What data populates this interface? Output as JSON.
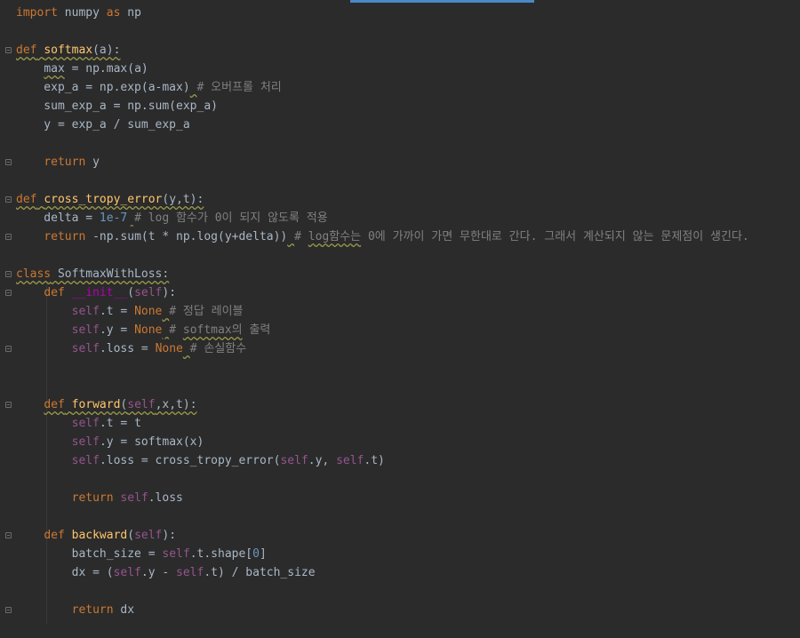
{
  "editor": {
    "lines": [
      [
        {
          "t": "import",
          "c": "kw"
        },
        {
          "t": " numpy "
        },
        {
          "t": "as",
          "c": "kw"
        },
        {
          "t": " np"
        }
      ],
      [],
      [
        {
          "t": "def",
          "c": "kw sqg"
        },
        {
          "t": " ",
          "c": "sqg"
        },
        {
          "t": "softmax",
          "c": "fn sqg"
        },
        {
          "t": "(a):",
          "c": "sqg"
        }
      ],
      [
        {
          "t": "    "
        },
        {
          "t": "max",
          "c": "sqg"
        },
        {
          "t": " = np.max(a)"
        }
      ],
      [
        {
          "t": "    exp_a = np.exp(a-max)"
        },
        {
          "t": " ",
          "c": "sqg"
        },
        {
          "t": "# 오버프롤 처리",
          "c": "cm"
        }
      ],
      [
        {
          "t": "    sum_exp_a = np.sum(exp_a)"
        }
      ],
      [
        {
          "t": "    y = exp_a / sum_exp_a"
        }
      ],
      [],
      [
        {
          "t": "    "
        },
        {
          "t": "return",
          "c": "kw"
        },
        {
          "t": " y"
        }
      ],
      [],
      [
        {
          "t": "def",
          "c": "kw sqg"
        },
        {
          "t": " ",
          "c": "sqg"
        },
        {
          "t": "cross_tropy_error",
          "c": "fn sqg"
        },
        {
          "t": "(y,t):",
          "c": "sqg"
        }
      ],
      [
        {
          "t": "    delta = "
        },
        {
          "t": "1e-7",
          "c": "num"
        },
        {
          "t": " ",
          "c": "sqg"
        },
        {
          "t": "# log 함수가 0이 되지 않도록 적용",
          "c": "cm"
        }
      ],
      [
        {
          "t": "    "
        },
        {
          "t": "return",
          "c": "kw"
        },
        {
          "t": " -np.sum(t * np.log(y+delta))"
        },
        {
          "t": " ",
          "c": "sqg"
        },
        {
          "t": "# ",
          "c": "cm"
        },
        {
          "t": "log함수는",
          "c": "cm sqg"
        },
        {
          "t": " 0에 가까이 가면 무한대로 간다. 그래서 계산되지 않는 문제점이 생긴다.",
          "c": "cm"
        }
      ],
      [],
      [
        {
          "t": "class",
          "c": "kw sqg"
        },
        {
          "t": " SoftmaxWithLoss:",
          "c": "sqg"
        }
      ],
      [
        {
          "t": "    "
        },
        {
          "t": "def",
          "c": "kw"
        },
        {
          "t": " "
        },
        {
          "t": "__init__",
          "c": "magic"
        },
        {
          "t": "("
        },
        {
          "t": "self",
          "c": "self"
        },
        {
          "t": "):"
        }
      ],
      [
        {
          "t": "        "
        },
        {
          "t": "self",
          "c": "self"
        },
        {
          "t": ".t = "
        },
        {
          "t": "None",
          "c": "kw"
        },
        {
          "t": " ",
          "c": "sqg"
        },
        {
          "t": "# 정답 레이블",
          "c": "cm"
        }
      ],
      [
        {
          "t": "        "
        },
        {
          "t": "self",
          "c": "self"
        },
        {
          "t": ".y = "
        },
        {
          "t": "None",
          "c": "kw"
        },
        {
          "t": " ",
          "c": "sqg"
        },
        {
          "t": "# ",
          "c": "cm"
        },
        {
          "t": "softmax의",
          "c": "cm sqg"
        },
        {
          "t": " 출력",
          "c": "cm"
        }
      ],
      [
        {
          "t": "        "
        },
        {
          "t": "self",
          "c": "self"
        },
        {
          "t": ".loss = "
        },
        {
          "t": "None",
          "c": "kw"
        },
        {
          "t": " ",
          "c": "sqg"
        },
        {
          "t": "# 손실함수",
          "c": "cm"
        }
      ],
      [],
      [],
      [
        {
          "t": "    "
        },
        {
          "t": "def",
          "c": "kw sqg"
        },
        {
          "t": " ",
          "c": "sqg"
        },
        {
          "t": "forward",
          "c": "fn sqg"
        },
        {
          "t": "(",
          "c": "sqg"
        },
        {
          "t": "self",
          "c": "self sqg"
        },
        {
          "t": ",x,t):",
          "c": "sqg"
        }
      ],
      [
        {
          "t": "        "
        },
        {
          "t": "self",
          "c": "self"
        },
        {
          "t": ".t = t"
        }
      ],
      [
        {
          "t": "        "
        },
        {
          "t": "self",
          "c": "self"
        },
        {
          "t": ".y = softmax(x)"
        }
      ],
      [
        {
          "t": "        "
        },
        {
          "t": "self",
          "c": "self"
        },
        {
          "t": ".loss = cross_tropy_error("
        },
        {
          "t": "self",
          "c": "self"
        },
        {
          "t": ".y, "
        },
        {
          "t": "self",
          "c": "self"
        },
        {
          "t": ".t)"
        }
      ],
      [],
      [
        {
          "t": "        "
        },
        {
          "t": "return",
          "c": "kw"
        },
        {
          "t": " "
        },
        {
          "t": "self",
          "c": "self"
        },
        {
          "t": ".loss"
        }
      ],
      [],
      [
        {
          "t": "    "
        },
        {
          "t": "def",
          "c": "kw"
        },
        {
          "t": " "
        },
        {
          "t": "backward",
          "c": "fn"
        },
        {
          "t": "("
        },
        {
          "t": "self",
          "c": "self"
        },
        {
          "t": "):"
        }
      ],
      [
        {
          "t": "        batch_size = "
        },
        {
          "t": "self",
          "c": "self"
        },
        {
          "t": ".t.shape["
        },
        {
          "t": "0",
          "c": "num"
        },
        {
          "t": "]"
        }
      ],
      [
        {
          "t": "        dx = ("
        },
        {
          "t": "self",
          "c": "self"
        },
        {
          "t": ".y - "
        },
        {
          "t": "self",
          "c": "self"
        },
        {
          "t": ".t) / batch_size"
        }
      ],
      [],
      [
        {
          "t": "        "
        },
        {
          "t": "return",
          "c": "kw"
        },
        {
          "t": " dx"
        }
      ],
      []
    ],
    "fold_lines": [
      2,
      8,
      10,
      12,
      14,
      15,
      18,
      21,
      28,
      32
    ]
  }
}
